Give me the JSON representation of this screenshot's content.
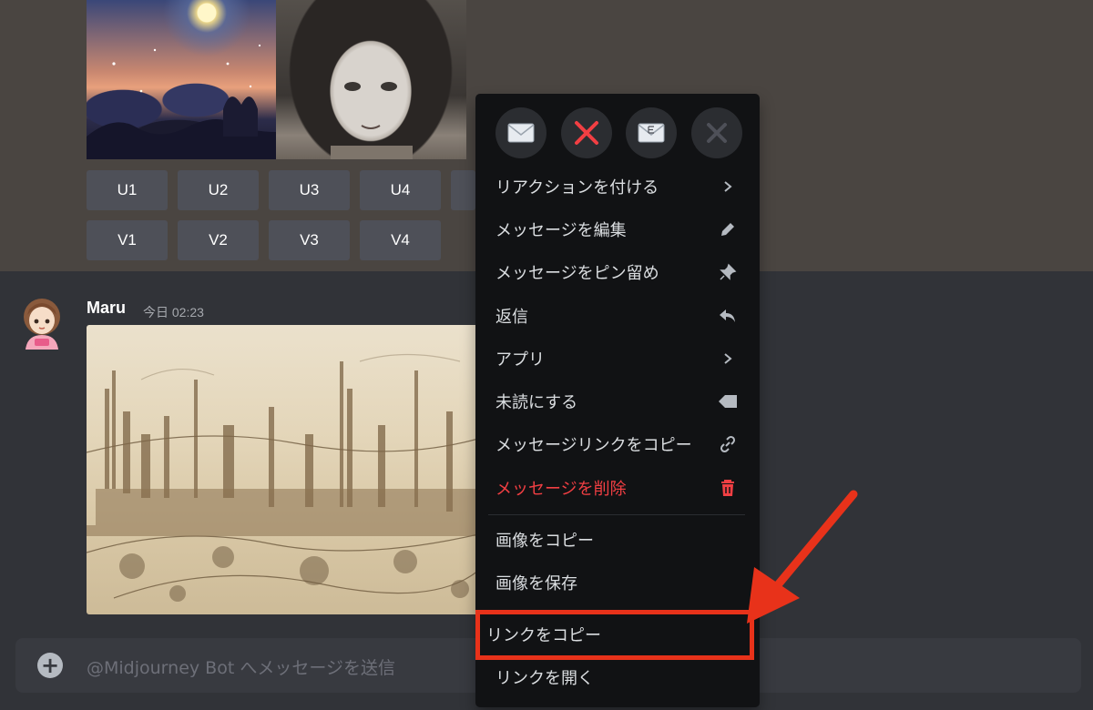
{
  "upscale_buttons": [
    "U1",
    "U2",
    "U3",
    "U4"
  ],
  "variation_buttons": [
    "V1",
    "V2",
    "V3",
    "V4"
  ],
  "message": {
    "author": "Maru",
    "timestamp": "今日 02:23",
    "avatar_badge": "GIRL"
  },
  "chat_input": {
    "placeholder": "@Midjourney Bot へメッセージを送信"
  },
  "context_menu": {
    "reactions": [
      "envelope-icon",
      "red-x-icon",
      "e-mail-icon",
      "grey-x-icon"
    ],
    "items": [
      {
        "label": "リアクションを付ける",
        "icon": "chevron-right-icon"
      },
      {
        "label": "メッセージを編集",
        "icon": "pencil-icon"
      },
      {
        "label": "メッセージをピン留め",
        "icon": "pin-icon"
      },
      {
        "label": "返信",
        "icon": "reply-icon"
      },
      {
        "label": "アプリ",
        "icon": "chevron-right-icon"
      },
      {
        "label": "未読にする",
        "icon": "unread-tag-icon"
      },
      {
        "label": "メッセージリンクをコピー",
        "icon": "link-icon"
      },
      {
        "label": "メッセージを削除",
        "icon": "trash-icon",
        "danger": true
      }
    ],
    "image_items": [
      {
        "label": "画像をコピー"
      },
      {
        "label": "画像を保存"
      },
      {
        "label": "リンクをコピー",
        "highlighted": true
      },
      {
        "label": "リンクを開く"
      }
    ]
  },
  "colors": {
    "danger": "#f23f43",
    "annotation": "#e8321a",
    "menu_bg": "#111214",
    "button_bg": "#4e5058"
  }
}
